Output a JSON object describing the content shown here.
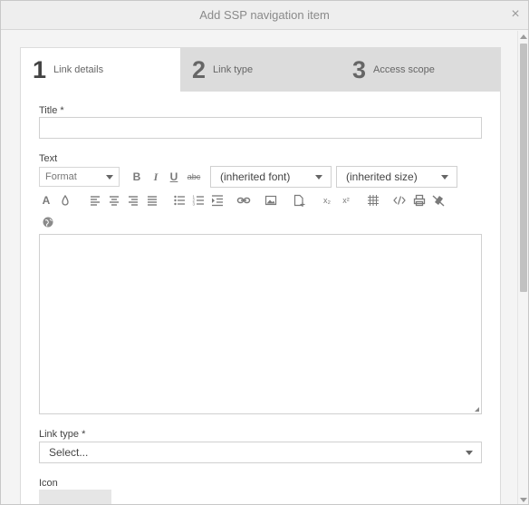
{
  "dialog": {
    "title": "Add SSP navigation item",
    "close_glyph": "×"
  },
  "tabs": [
    {
      "number": "1",
      "label": "Link details"
    },
    {
      "number": "2",
      "label": "Link type"
    },
    {
      "number": "3",
      "label": "Access scope"
    }
  ],
  "form": {
    "title_label": "Title *",
    "title_value": "",
    "text_label": "Text",
    "format_label": "Format",
    "font_select": "(inherited font)",
    "size_select": "(inherited size)",
    "link_type_label": "Link type *",
    "link_type_select": "Select...",
    "icon_label": "Icon"
  },
  "toolbar": {
    "bold": "B",
    "italic": "I",
    "underline": "U",
    "strikethrough": "abc",
    "font_color": "A",
    "subscript": "x₂",
    "superscript": "x²",
    "icons": [
      "bold-icon",
      "italic-icon",
      "underline-icon",
      "strikethrough-icon",
      "font-color-icon",
      "background-color-icon",
      "align-left-icon",
      "align-center-icon",
      "align-right-icon",
      "align-justify-icon",
      "bullet-list-icon",
      "numbered-list-icon",
      "indent-icon",
      "link-icon",
      "image-icon",
      "insert-document-icon",
      "subscript-icon",
      "superscript-icon",
      "table-icon",
      "source-code-icon",
      "print-icon",
      "clear-format-icon",
      "globe-icon"
    ]
  },
  "colors": {
    "title_text": "#8a8a8a",
    "tab_inactive_bg": "#dcdcdc",
    "tab_active_bg": "#ffffff",
    "border": "#d0d0d0"
  }
}
